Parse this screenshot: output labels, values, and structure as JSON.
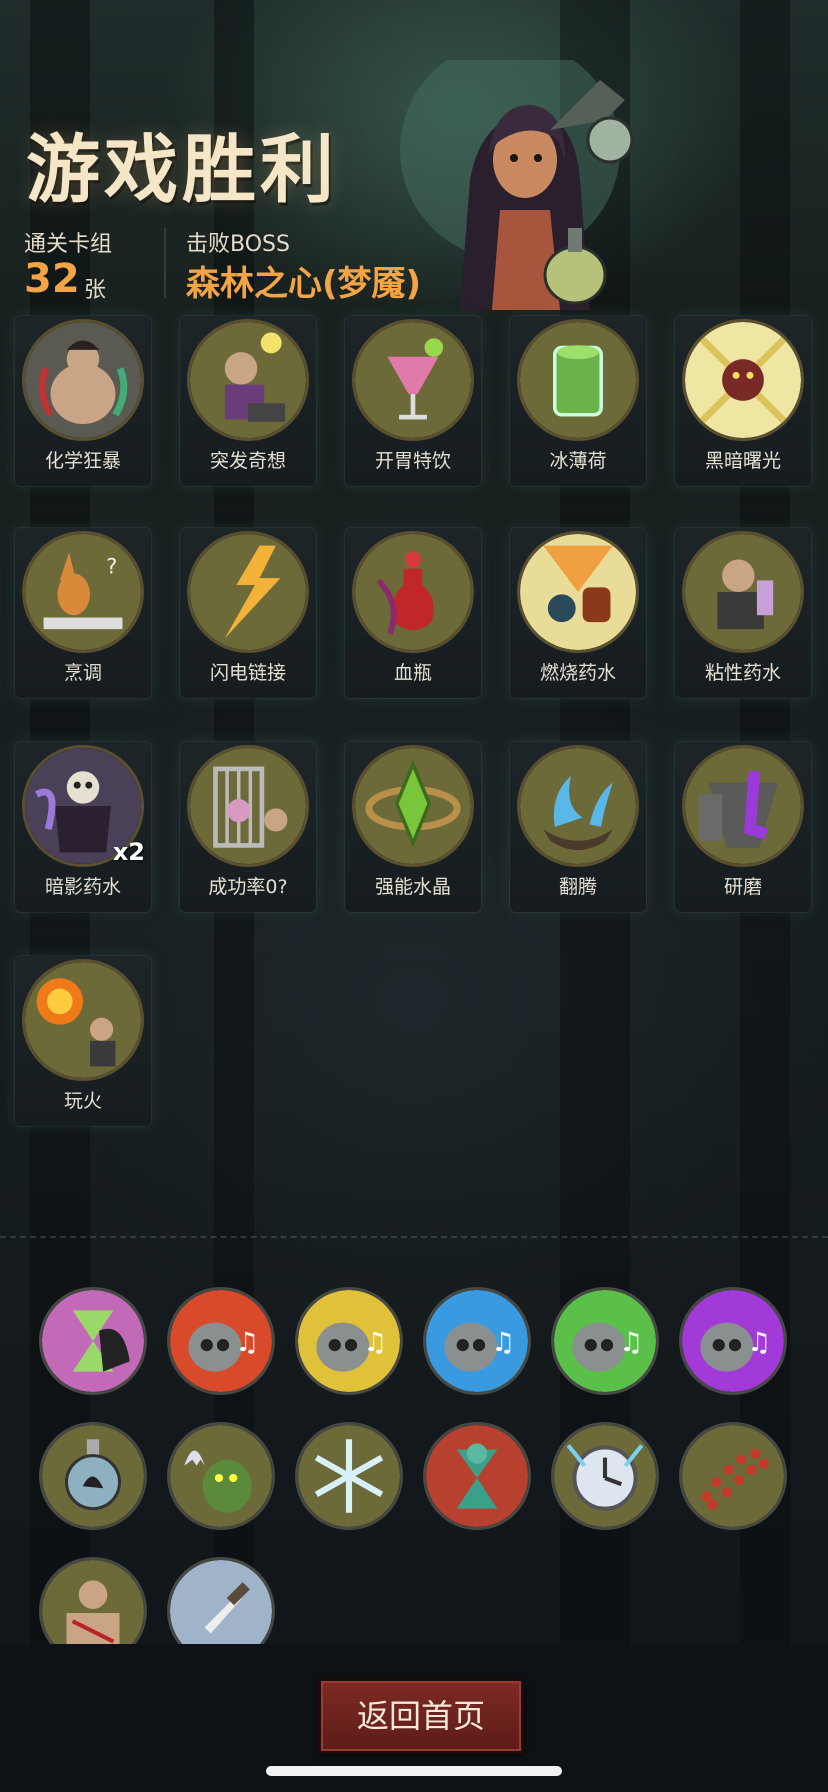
{
  "header": {
    "title": "游戏胜利",
    "deck_label": "通关卡组",
    "deck_count": "32",
    "deck_unit": "张",
    "boss_label": "击败BOSS",
    "boss_name": "森林之心(梦魇)"
  },
  "colors": {
    "accent_orange": "#f3a545",
    "button_red": "#6e2620",
    "coin_olive": "#6d6a3a"
  },
  "cards": [
    {
      "label": "化学狂暴",
      "icon": "chemical-rage-icon"
    },
    {
      "label": "突发奇想",
      "icon": "sudden-idea-icon"
    },
    {
      "label": "开胃特饮",
      "icon": "appetizer-drink-icon"
    },
    {
      "label": "冰薄荷",
      "icon": "ice-mint-icon"
    },
    {
      "label": "黑暗曙光",
      "icon": "dark-dawn-icon"
    },
    {
      "label": "烹调",
      "icon": "cooking-icon"
    },
    {
      "label": "闪电链接",
      "icon": "lightning-link-icon"
    },
    {
      "label": "血瓶",
      "icon": "blood-bottle-icon"
    },
    {
      "label": "燃烧药水",
      "icon": "burning-potion-icon"
    },
    {
      "label": "粘性药水",
      "icon": "sticky-potion-icon"
    },
    {
      "label": "暗影药水",
      "icon": "shadow-potion-icon",
      "multiplier": "x2"
    },
    {
      "label": "成功率0?",
      "icon": "success-rate-icon"
    },
    {
      "label": "强能水晶",
      "icon": "power-crystal-icon"
    },
    {
      "label": "翻腾",
      "icon": "churning-icon"
    },
    {
      "label": "研磨",
      "icon": "grinding-icon"
    },
    {
      "label": "玩火",
      "icon": "play-fire-icon"
    }
  ],
  "relics": [
    {
      "icon": "hourglass-relic-icon"
    },
    {
      "icon": "red-music-skull-relic-icon"
    },
    {
      "icon": "yellow-music-skull-relic-icon"
    },
    {
      "icon": "blue-music-skull-relic-icon"
    },
    {
      "icon": "green-music-skull-relic-icon"
    },
    {
      "icon": "purple-music-skull-relic-icon"
    },
    {
      "icon": "potion-flask-relic-icon"
    },
    {
      "icon": "ghost-ogre-relic-icon"
    },
    {
      "icon": "snowflake-relic-icon"
    },
    {
      "icon": "horned-hourglass-relic-icon"
    },
    {
      "icon": "clock-relic-icon"
    },
    {
      "icon": "dna-helix-relic-icon"
    },
    {
      "icon": "wrapped-fists-relic-icon"
    },
    {
      "icon": "dagger-relic-icon"
    }
  ],
  "buttons": {
    "return_home": "返回首页"
  }
}
